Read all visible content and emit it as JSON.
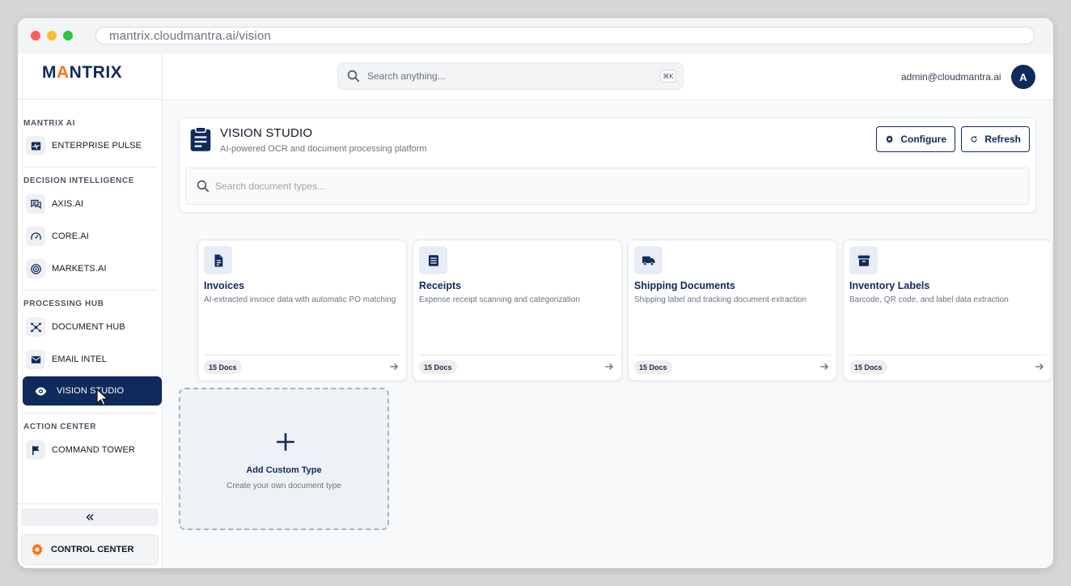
{
  "browser": {
    "url": "mantrix.cloudmantra.ai/vision"
  },
  "brand": {
    "logo_text_pre": "M",
    "logo_text_accent": "A",
    "logo_text_post": "NTRIX",
    "accent_color": "#f97316",
    "primary_color": "#0f2a5c"
  },
  "sidebar": {
    "sections": [
      {
        "label": "MANTRIX AI",
        "items": [
          {
            "label": "ENTERPRISE PULSE",
            "icon": "pulse-icon"
          }
        ]
      },
      {
        "label": "DECISION INTELLIGENCE",
        "items": [
          {
            "label": "AXIS.AI",
            "icon": "chat-icon"
          },
          {
            "label": "CORE.AI",
            "icon": "gauge-icon"
          },
          {
            "label": "MARKETS.AI",
            "icon": "target-icon"
          }
        ]
      },
      {
        "label": "PROCESSING HUB",
        "items": [
          {
            "label": "DOCUMENT HUB",
            "icon": "hub-icon"
          },
          {
            "label": "EMAIL INTEL",
            "icon": "mail-icon"
          },
          {
            "label": "VISION STUDIO",
            "icon": "eye-icon",
            "active": true
          }
        ]
      },
      {
        "label": "ACTION CENTER",
        "items": [
          {
            "label": "COMMAND TOWER",
            "icon": "flag-icon"
          }
        ]
      }
    ],
    "control_center_label": "CONTROL CENTER"
  },
  "topbar": {
    "search_placeholder": "Search anything...",
    "shortcut": "⌘K",
    "user_email": "admin@cloudmantra.ai",
    "avatar_initial": "A"
  },
  "header": {
    "title": "VISION STUDIO",
    "subtitle": "AI-powered OCR and document processing platform",
    "configure_label": "Configure",
    "refresh_label": "Refresh",
    "search_placeholder": "Search document types..."
  },
  "doc_types": [
    {
      "title": "Invoices",
      "description": "AI-extracted invoice data with automatic PO matching",
      "badge": "15 Docs",
      "icon": "document-icon"
    },
    {
      "title": "Receipts",
      "description": "Expense receipt scanning and categorization",
      "badge": "15 Docs",
      "icon": "receipt-icon"
    },
    {
      "title": "Shipping Documents",
      "description": "Shipping label and tracking document extraction",
      "badge": "15 Docs",
      "icon": "truck-icon"
    },
    {
      "title": "Inventory Labels",
      "description": "Barcode, QR code, and label data extraction",
      "badge": "15 Docs",
      "icon": "archive-icon"
    }
  ],
  "add_custom": {
    "title": "Add Custom Type",
    "description": "Create your own document type"
  }
}
